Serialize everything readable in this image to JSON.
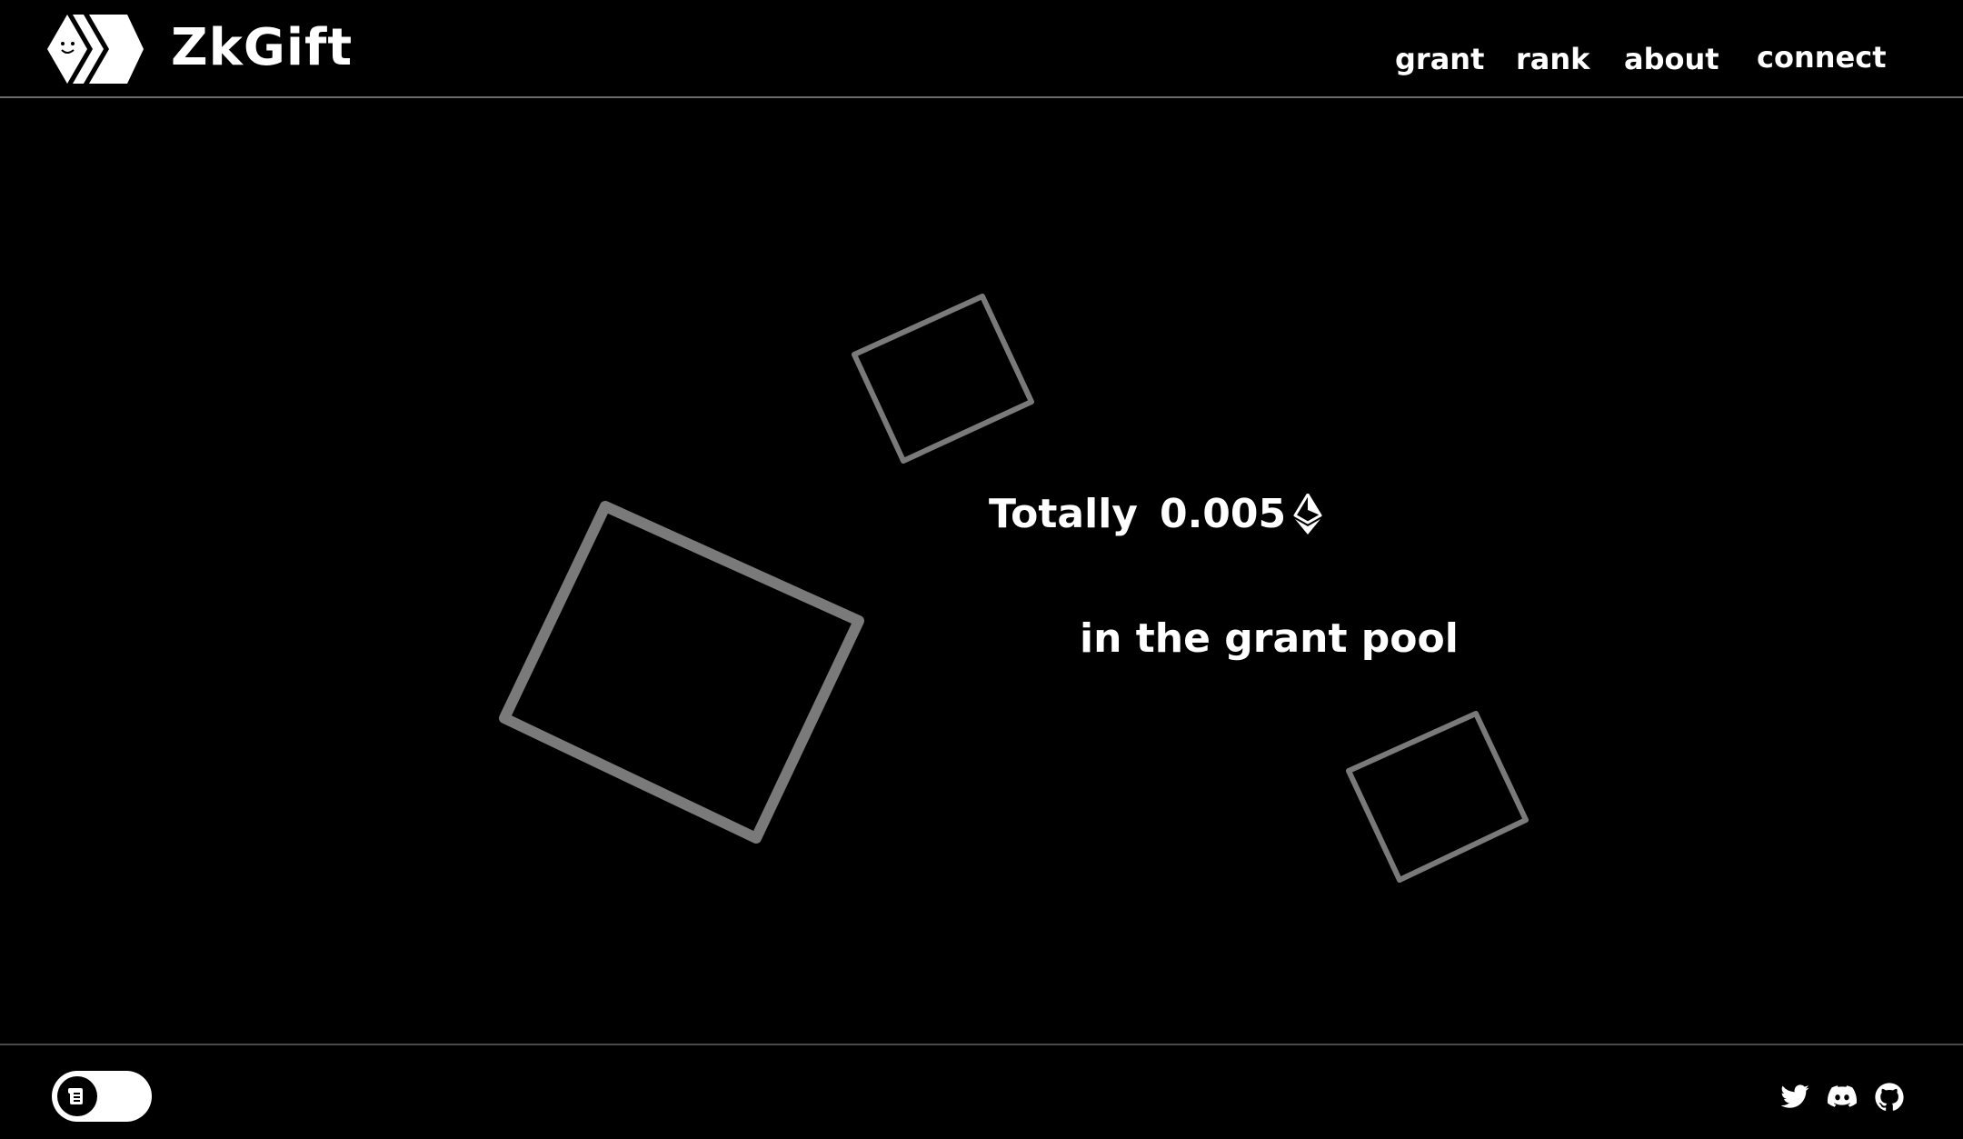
{
  "header": {
    "brand": "ZkGift",
    "logo_icon": "cube-face-logo-icon",
    "nav": [
      {
        "label": "grant"
      },
      {
        "label": "rank"
      },
      {
        "label": "about"
      },
      {
        "label": "connect"
      }
    ]
  },
  "main": {
    "total_prefix": "Totally",
    "total_amount": "0.005",
    "currency_icon": "ethereum-icon",
    "pool_text": "in the grant pool",
    "shape_color": "#7a7a7a"
  },
  "footer": {
    "toggle_icon": "scroll-icon",
    "socials": [
      {
        "icon": "twitter-icon"
      },
      {
        "icon": "discord-icon"
      },
      {
        "icon": "github-icon"
      }
    ]
  },
  "colors": {
    "background": "#000000",
    "text": "#ffffff",
    "divider": "#6a6a6a"
  }
}
